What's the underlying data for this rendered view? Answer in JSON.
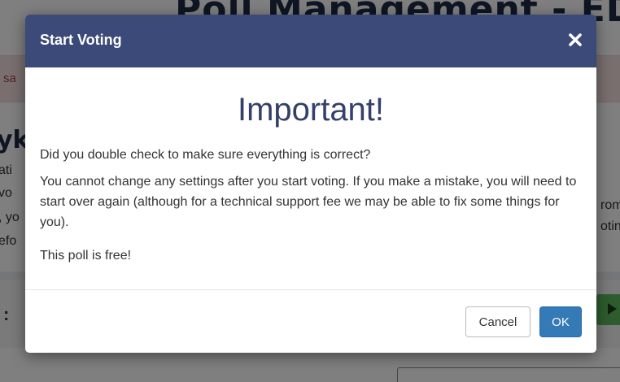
{
  "background": {
    "title": "Poll Management - EDITING",
    "alert_text": "sa",
    "heading": "yk",
    "left_lines": [
      "ati",
      "vo",
      ", yo",
      "efo"
    ],
    "right_lines": [
      "rom",
      "otin"
    ]
  },
  "modal": {
    "title": "Start Voting",
    "close_icon": "close-icon",
    "heading": "Important!",
    "paragraph1": "Did you double check to make sure everything is correct?",
    "paragraph2": "You cannot change any settings after you start voting. If you make a mistake, you will need to start over again (although for a technical support fee we may be able to fix some things for you).",
    "paragraph3": "This poll is free!",
    "cancel_label": "Cancel",
    "ok_label": "OK"
  },
  "colors": {
    "header": "#3b4a78",
    "heading_text": "#34406a",
    "ok_button": "#337ab7"
  }
}
